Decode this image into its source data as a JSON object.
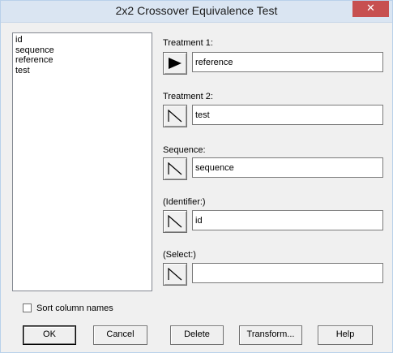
{
  "window": {
    "title": "2x2 Crossover Equivalence Test",
    "close_glyph": "✕"
  },
  "columns_list": {
    "items": [
      "id",
      "sequence",
      "reference",
      "test"
    ]
  },
  "fields": [
    {
      "label": "Treatment 1:",
      "value": "reference",
      "arrow_icon": "play-arrow-icon-filled"
    },
    {
      "label": "Treatment 2:",
      "value": "test",
      "arrow_icon": "arrow-outline-icon"
    },
    {
      "label": "Sequence:",
      "value": "sequence",
      "arrow_icon": "arrow-outline-icon"
    },
    {
      "label": "(Identifier:)",
      "value": "id",
      "arrow_icon": "arrow-outline-icon"
    },
    {
      "label": "(Select:)",
      "value": "",
      "arrow_icon": "arrow-outline-icon"
    }
  ],
  "sort_checkbox": {
    "label": "Sort column names",
    "checked": false
  },
  "buttons": {
    "ok": "OK",
    "cancel": "Cancel",
    "delete": "Delete",
    "transform": "Transform...",
    "help": "Help"
  }
}
